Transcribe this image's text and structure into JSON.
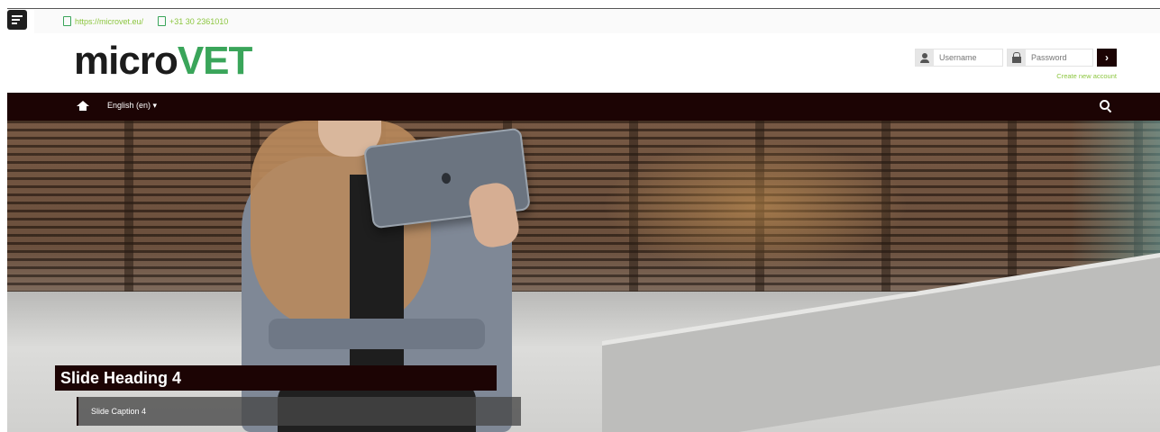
{
  "contact": {
    "url": "https://microvet.eu/",
    "phone": "+31 30 2361010"
  },
  "logo": {
    "part1": "micro",
    "part2": "VET"
  },
  "login": {
    "username_placeholder": "Username",
    "password_placeholder": "Password",
    "submit_label": "›",
    "create_account": "Create new account"
  },
  "nav": {
    "language": "English (en) ▾"
  },
  "slide": {
    "heading": "Slide Heading 4",
    "caption": "Slide Caption 4"
  },
  "colors": {
    "brand_dark": "#1c0404",
    "brand_green": "#3aa55a",
    "link_green": "#8cc63f"
  }
}
